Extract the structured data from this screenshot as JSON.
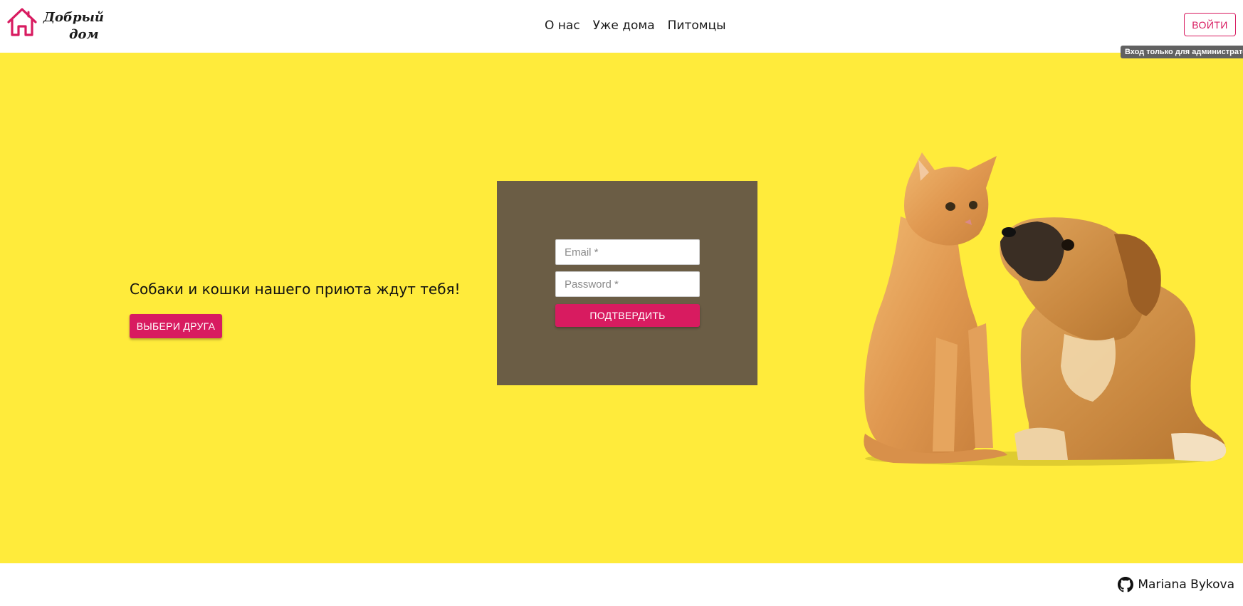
{
  "header": {
    "logo": {
      "line1": "Добрый",
      "line2": "дом"
    },
    "nav": [
      {
        "label": "О нас"
      },
      {
        "label": "Уже дома"
      },
      {
        "label": "Питомцы"
      }
    ],
    "login_label": "ВОЙТИ",
    "login_tooltip": "Вход только для администратора"
  },
  "hero": {
    "title": "Собаки и кошки нашего приюта ждут тебя!",
    "cta_label": "ВЫБЕРИ ДРУГА",
    "image_subject": "kitten-and-puppy"
  },
  "login_form": {
    "email_placeholder": "Email *",
    "password_placeholder": "Password *",
    "submit_label": "ПОДТВЕРДИТЬ"
  },
  "footer": {
    "author": "Mariana Bykova",
    "icon": "github-icon"
  },
  "colors": {
    "accent": "#d81b60",
    "hero_bg": "#ffeb3b",
    "panel_bg": "#6b5d45",
    "tooltip_bg": "#616161"
  }
}
